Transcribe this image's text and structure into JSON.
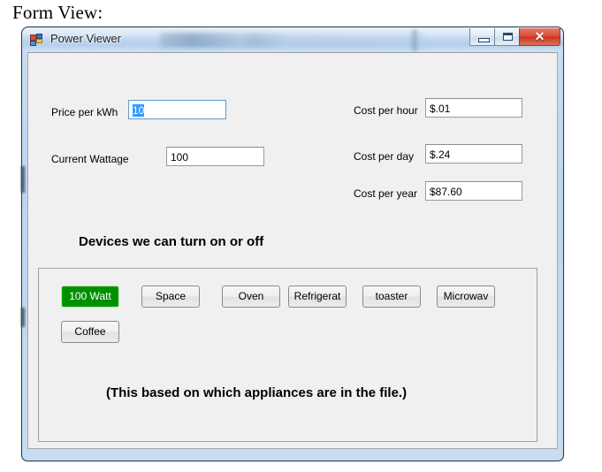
{
  "page": {
    "heading": "Form View:"
  },
  "window": {
    "title": "Power Viewer",
    "icon": "winforms-app-icon",
    "controls": {
      "minimize": "Minimize",
      "maximize": "Maximize",
      "close": "✕"
    }
  },
  "form": {
    "fields": [
      {
        "label": "Price per kWh",
        "value": "10",
        "name": "price-per-kwh",
        "selected": true,
        "focused": true
      },
      {
        "label": "Current Wattage",
        "value": "100",
        "name": "current-wattage",
        "selected": false,
        "focused": false
      },
      {
        "label": "Cost per hour",
        "value": "$.01",
        "name": "cost-per-hour",
        "selected": false,
        "focused": false
      },
      {
        "label": "Cost per day",
        "value": "$.24",
        "name": "cost-per-day",
        "selected": false,
        "focused": false
      },
      {
        "label": "Cost per year",
        "value": "$87.60",
        "name": "cost-per-year",
        "selected": false,
        "focused": false
      }
    ]
  },
  "devices": {
    "heading": "Devices we can turn on or off",
    "buttons": [
      {
        "label": "100 Watt",
        "active": true
      },
      {
        "label": "Space",
        "active": false
      },
      {
        "label": "Oven",
        "active": false
      },
      {
        "label": "Refrigerat",
        "active": false
      },
      {
        "label": "toaster",
        "active": false
      },
      {
        "label": "Microwav",
        "active": false
      },
      {
        "label": "Coffee",
        "active": false
      }
    ],
    "note": "(This based on which appliances are in the file.)"
  },
  "colors": {
    "active_button": "#009000",
    "selection": "#3399ff",
    "client_background": "#f0f0f0",
    "frame_glass": "#bdd5ee",
    "close_button": "#c53824"
  }
}
